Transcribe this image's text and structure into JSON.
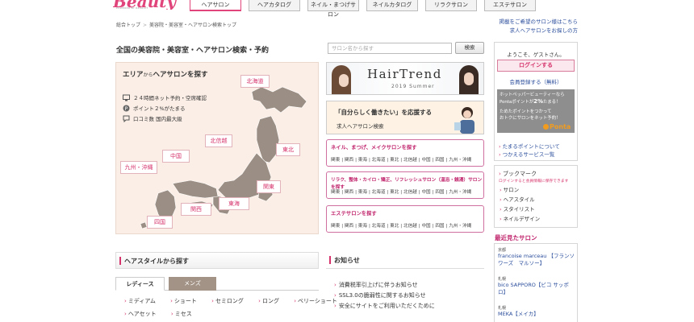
{
  "brand": {
    "logo": "Beauty",
    "sub": "POWERED BY RECRUIT"
  },
  "nav": {
    "tabs": [
      "ヘアサロン",
      "ヘアカタログ",
      "ネイル・まつげサロン",
      "ネイルカタログ",
      "リラクサロン",
      "エステサロン"
    ]
  },
  "breadcrumb": [
    "総合トップ",
    "美容院・美容室・ヘアサロン検索トップ"
  ],
  "header_links": [
    "掲載をご希望のサロン様はこちら",
    "求人ヘアサロンをお探しの方"
  ],
  "page_title": "全国の美容院・美容室・ヘアサロン検索・予約",
  "search": {
    "placeholder": "サロン名から探す",
    "button": "検索"
  },
  "map": {
    "title_main": "エリア",
    "title_small": "から",
    "title_rest": "ヘアサロンを探す",
    "features": [
      "２４時間ネット予約・空席確認",
      "ポイント２%がたまる",
      "口コミ数 国内最大級"
    ],
    "regions": [
      "北海道",
      "東北",
      "北信越",
      "関東",
      "中国",
      "東海",
      "関西",
      "九州・沖縄",
      "四国"
    ]
  },
  "banners": {
    "hair_trend": {
      "title": "HairTrend",
      "sub": "2019 Summer"
    },
    "recruit": {
      "main": "「自分らしく働きたい」を応援する",
      "sub": "求人ヘアサロン検索"
    }
  },
  "categories": [
    {
      "title": "ネイル、まつげ、メイクサロンを探す"
    },
    {
      "title": "リラク、整体・カイロ・矯正、リフレッシュサロン（温浴・銭湯）サロンを探す"
    },
    {
      "title": "エステサロンを探す"
    }
  ],
  "category_areas": [
    "関東",
    "関西",
    "東海",
    "北海道",
    "東北",
    "北信越",
    "中国",
    "四国",
    "九州・沖縄"
  ],
  "sidebar": {
    "welcome": "ようこそ、ゲストさん。",
    "login": "ログインする",
    "register": "会員登録する（無料）",
    "ponta": {
      "line1": "ホットペッパービューティーなら",
      "line2a": "Pontaポイントが",
      "line2b": "2%",
      "line2c": "たまる！",
      "line3": "ためたポイントをつかって",
      "line4": "おトクにサロンをネット予約！",
      "logo": "Ponta"
    },
    "links": [
      "たまるポイントについて",
      "つかえるサービス一覧"
    ],
    "bookmark": {
      "title": "ブックマーク",
      "note": "ログインすると会員情報に保存できます",
      "items": [
        "サロン",
        "ヘアスタイル",
        "スタイリスト",
        "ネイルデザイン"
      ]
    },
    "recent": {
      "title": "最近見たサロン",
      "items": [
        {
          "area": "京都",
          "name": "francoise marceau 【フランソワーズ　マルソー】"
        },
        {
          "area": "札幌",
          "name": "bico SAPPORO【ビコ サッポロ】"
        },
        {
          "area": "札幌",
          "name": "MEKA【メイカ】"
        }
      ]
    }
  },
  "hairstyle": {
    "title": "ヘアスタイルから探す",
    "tabs": [
      "レディース",
      "メンズ"
    ],
    "row1": [
      "ミディアム",
      "ショート",
      "セミロング",
      "ロング",
      "ベリーショート"
    ],
    "row2": [
      "ヘアセット",
      "ミセス"
    ]
  },
  "news": {
    "title": "お知らせ",
    "items": [
      "消費税率引上げに伴うお知らせ",
      "SSL3.0の脆弱性に関するお知らせ",
      "安全にサイトをご利用いただくために"
    ]
  },
  "colors": {
    "accent": "#d6336c",
    "link": "#2a4d9b",
    "map_bg": "#fbeee6",
    "land": "#9b8e84"
  }
}
